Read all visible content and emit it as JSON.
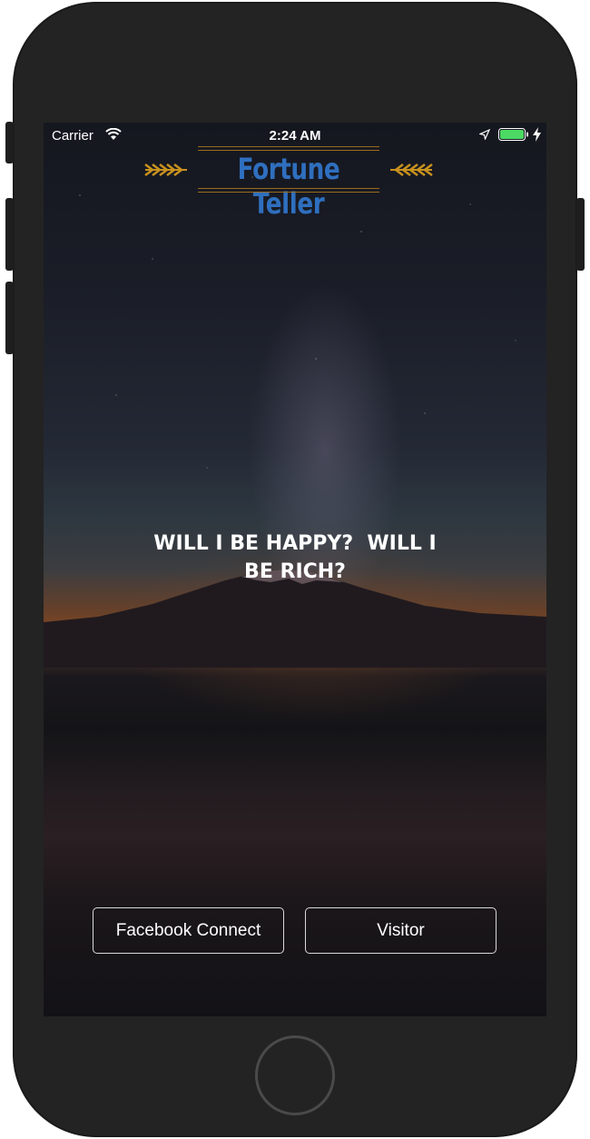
{
  "status_bar": {
    "carrier": "Carrier",
    "time": "2:24 AM",
    "battery_color": "#4cd964"
  },
  "logo": {
    "title": "Fortune Teller",
    "title_color": "#2f6fbf",
    "ornament_color": "#c8911e"
  },
  "main": {
    "headline": "WILL I BE HAPPY?  WILL I\nBE RICH?"
  },
  "actions": {
    "facebook_label": "Facebook Connect",
    "visitor_label": "Visitor"
  },
  "icons": {
    "wifi": "wifi-icon",
    "location": "location-arrow-icon",
    "battery": "battery-icon",
    "charging": "charging-bolt-icon",
    "logo_ornament": "wheat-arrows-icon"
  }
}
